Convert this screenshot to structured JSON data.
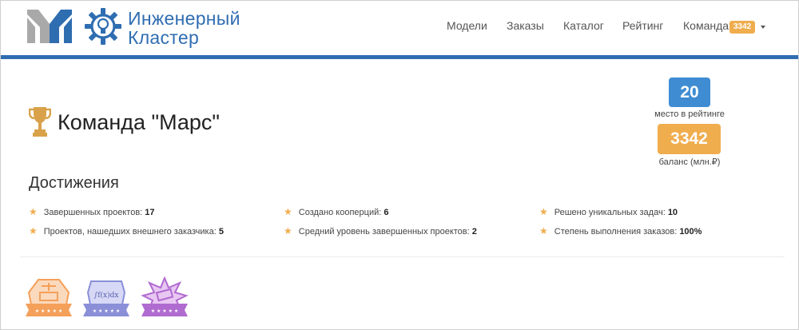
{
  "brand": {
    "name_line1": "Инженерный",
    "name_line2": "Кластер",
    "colors": {
      "primary": "#2f6db1",
      "gray": "#a9a9a9"
    },
    "icons": [
      "y-logo-icon",
      "gear-lightbulb-icon"
    ]
  },
  "nav": {
    "items": [
      {
        "label": "Модели"
      },
      {
        "label": "Заказы"
      },
      {
        "label": "Каталог"
      },
      {
        "label": "Рейтинг"
      },
      {
        "label": "Команда"
      }
    ],
    "team_badge": "3342",
    "badge_color": "#f0ad4e",
    "dropdown_icon": "caret-down-icon"
  },
  "team": {
    "title": "Команда \"Марс\"",
    "icon": "trophy-icon",
    "icon_color": "#d9a24a"
  },
  "stats": {
    "rank_value": "20",
    "rank_label": "место в рейтинге",
    "rank_color": "#3f8cd2",
    "balance_value": "3342",
    "balance_label": "баланс (млн.₽)",
    "balance_color": "#f0ad4e"
  },
  "achievements": {
    "title": "Достижения",
    "star_icon": "star-icon",
    "items": [
      {
        "label": "Завершенных проектов:",
        "value": "17"
      },
      {
        "label": "Создано кооперций:",
        "value": "6"
      },
      {
        "label": "Решено уникальных задач:",
        "value": "10"
      },
      {
        "label": "Проектов, нашедших внешнего заказчика:",
        "value": "5"
      },
      {
        "label": "Средний уровень завершенных проектов:",
        "value": "2"
      },
      {
        "label": "Степень выполнения заказов:",
        "value": "100%"
      }
    ]
  },
  "badges": [
    {
      "icon": "engineering-badge-icon",
      "color": "#f4a05a"
    },
    {
      "icon": "formula-badge-icon",
      "text": "∫f(x)dx",
      "color": "#8a8fd8"
    },
    {
      "icon": "star-ribbon-badge-icon",
      "color": "#b06bd0"
    }
  ]
}
